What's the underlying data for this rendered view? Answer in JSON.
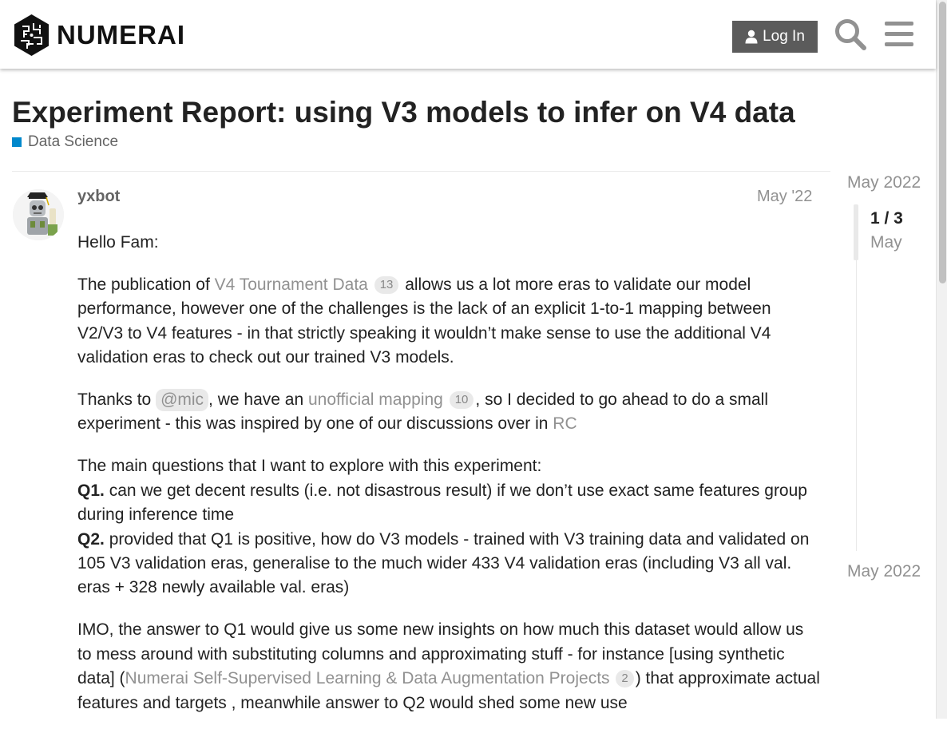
{
  "header": {
    "logo_text": "NUMERAI",
    "login_label": "Log In"
  },
  "topic": {
    "title": "Experiment Report: using V3 models to infer on V4 data",
    "category": "Data Science",
    "category_color": "#0088cc"
  },
  "post": {
    "username": "yxbot",
    "date": "May '22",
    "greeting": "Hello Fam:",
    "p1": {
      "t1": "The publication of ",
      "link1": "V4 Tournament Data",
      "link1_count": "13",
      "t2": " allows us a lot more eras to validate our model performance, however one of the challenges is the lack of an explicit 1-to-1 mapping between V2/V3 to V4 features - in that strictly speaking it wouldn’t make sense to use the additional V4 validation eras to check out our trained V3 models."
    },
    "p2": {
      "t1": "Thanks to ",
      "mention": "@mic",
      "t2": ", we have an ",
      "link": "unofficial mapping",
      "link_count": "10",
      "t3": ", so I decided to go ahead to do a small experiment - this was inspired by one of our discussions over in ",
      "link2": "RC"
    },
    "p3": {
      "intro": "The main questions that I want to explore with this experiment:",
      "q1_label": "Q1.",
      "q1_text": " can we get decent results (i.e. not disastrous result) if we don’t use exact same features group during inference time",
      "q2_label": "Q2.",
      "q2_text": " provided that Q1 is positive, how do V3 models - trained with V3 training data and validated on 105 V3 validation eras, generalise to the much wider 433 V4 validation eras (including V3 all val. eras + 328 newly available val. eras)"
    },
    "p4": {
      "t1": "IMO, the answer to Q1 would give us some new insights on how much this dataset would allow us to mess around with substituting columns and approximating stuff - for instance [using synthetic data] (",
      "link": "Numerai Self-Supervised Learning & Data Augmentation Projects",
      "link_count": "2",
      "t2": ") that approximate actual features and targets , meanwhile answer to Q2 would shed some new use"
    }
  },
  "timeline": {
    "top_date": "May 2022",
    "position": "1 / 3",
    "current": "May",
    "bottom_date": "May 2022"
  }
}
